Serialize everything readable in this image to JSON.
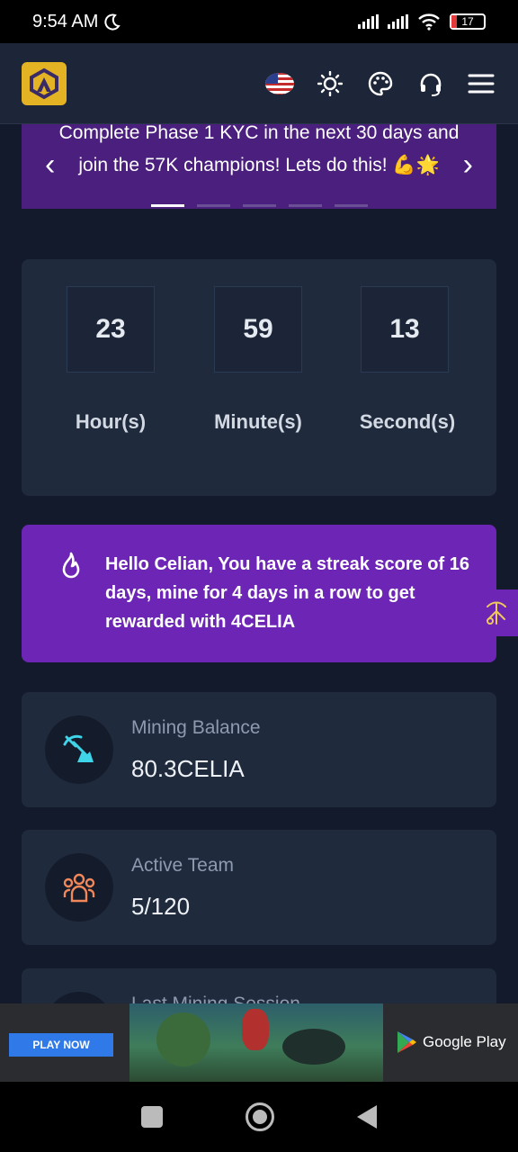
{
  "status_bar": {
    "time": "9:54 AM",
    "battery": "17"
  },
  "header": {
    "logo_icon": "celia-logo-icon",
    "icons": [
      "us-flag-icon",
      "sun-icon",
      "palette-icon",
      "headset-icon",
      "menu-icon"
    ]
  },
  "banner": {
    "text": "Complete Phase 1 KYC in the next 30 days and join the 57K champions! Lets do this! 💪🌟",
    "prev": "‹",
    "next": "›",
    "slides": 5,
    "active_slide": 1
  },
  "timer": {
    "hours": "23",
    "minutes": "59",
    "seconds": "13",
    "hours_label": "Hour(s)",
    "minutes_label": "Minute(s)",
    "seconds_label": "Second(s)"
  },
  "streak": {
    "message": "Hello Celian, You have a streak score of 16 days, mine for 4 days in a row to get rewarded with 4CELIA"
  },
  "stats": {
    "mining": {
      "label": "Mining Balance",
      "value": "80.3CELIA"
    },
    "team": {
      "label": "Active Team",
      "value": "5/120"
    },
    "session": {
      "label": "Last Mining Session"
    }
  },
  "ad": {
    "play_now": "PLAY NOW",
    "store": "Google Play"
  },
  "colors": {
    "accent_purple": "#6c25b4",
    "logo_yellow": "#e4b323",
    "card": "#1f2a3d",
    "background": "#121a2b"
  }
}
